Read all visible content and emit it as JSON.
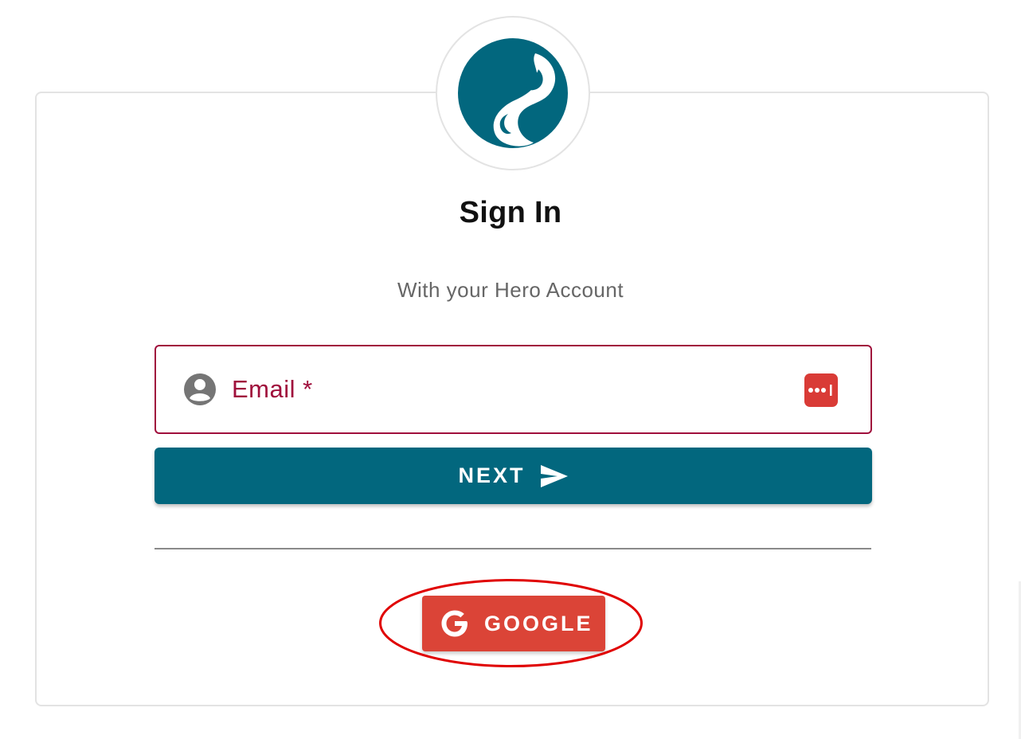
{
  "header": {
    "logo_icon": "hero-swirl-logo",
    "title": "Sign In",
    "subtitle": "With your Hero Account"
  },
  "form": {
    "email_label": "Email *",
    "user_icon": "account-circle-icon",
    "password_manager_icon": "password-manager-icon",
    "next_label": "NEXT",
    "next_icon": "send-icon"
  },
  "social": {
    "google_label": "GOOGLE",
    "google_icon": "google-g-icon"
  },
  "colors": {
    "brand": "#02677e",
    "error": "#a00f3c",
    "google": "#db4437",
    "highlight": "#e00000"
  }
}
